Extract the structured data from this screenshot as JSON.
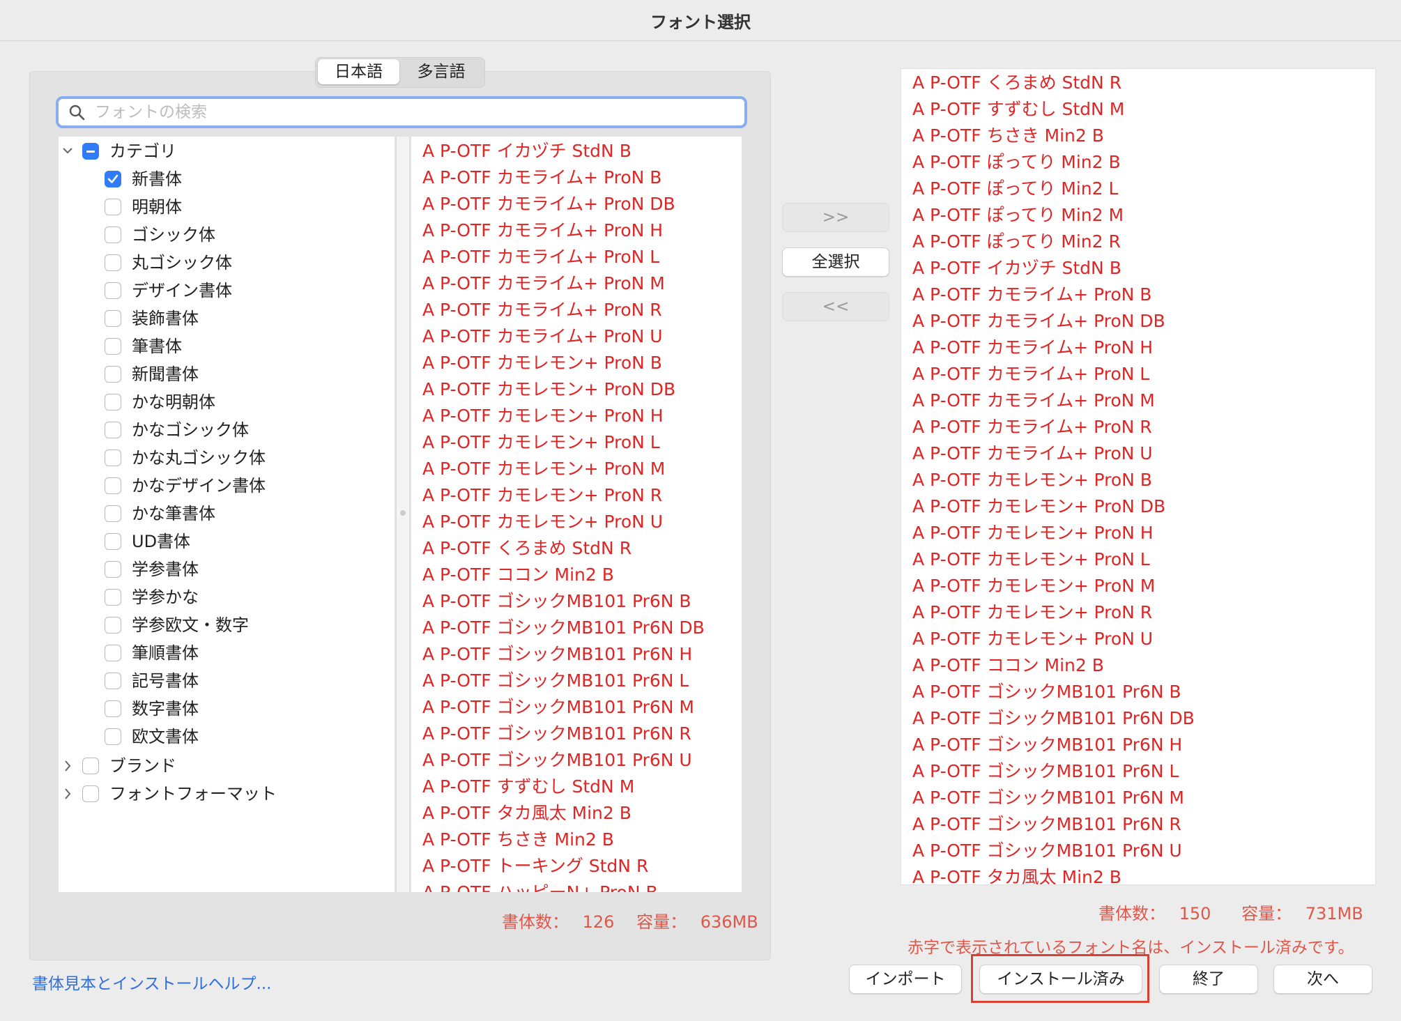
{
  "window": {
    "title": "フォント選択"
  },
  "tabs": [
    {
      "label": "日本語",
      "selected": true
    },
    {
      "label": "多言語",
      "selected": false
    }
  ],
  "search": {
    "placeholder": "フォントの検索",
    "value": ""
  },
  "tree": {
    "category": {
      "label": "カテゴリ",
      "state": "mixed",
      "expanded": true
    },
    "subcategories": [
      {
        "label": "新書体",
        "checked": true
      },
      {
        "label": "明朝体",
        "checked": false
      },
      {
        "label": "ゴシック体",
        "checked": false
      },
      {
        "label": "丸ゴシック体",
        "checked": false
      },
      {
        "label": "デザイン書体",
        "checked": false
      },
      {
        "label": "装飾書体",
        "checked": false
      },
      {
        "label": "筆書体",
        "checked": false
      },
      {
        "label": "新聞書体",
        "checked": false
      },
      {
        "label": "かな明朝体",
        "checked": false
      },
      {
        "label": "かなゴシック体",
        "checked": false
      },
      {
        "label": "かな丸ゴシック体",
        "checked": false
      },
      {
        "label": "かなデザイン書体",
        "checked": false
      },
      {
        "label": "かな筆書体",
        "checked": false
      },
      {
        "label": "UD書体",
        "checked": false
      },
      {
        "label": "学参書体",
        "checked": false
      },
      {
        "label": "学参かな",
        "checked": false
      },
      {
        "label": "学参欧文・数字",
        "checked": false
      },
      {
        "label": "筆順書体",
        "checked": false
      },
      {
        "label": "記号書体",
        "checked": false
      },
      {
        "label": "数字書体",
        "checked": false
      },
      {
        "label": "欧文書体",
        "checked": false
      }
    ],
    "groups": [
      {
        "label": "ブランド",
        "checked": false,
        "expanded": false
      },
      {
        "label": "フォントフォーマット",
        "checked": false,
        "expanded": false
      }
    ]
  },
  "available_fonts": [
    "A P-OTF イカヅチ StdN B",
    "A P-OTF カモライム+ ProN B",
    "A P-OTF カモライム+ ProN DB",
    "A P-OTF カモライム+ ProN H",
    "A P-OTF カモライム+ ProN L",
    "A P-OTF カモライム+ ProN M",
    "A P-OTF カモライム+ ProN R",
    "A P-OTF カモライム+ ProN U",
    "A P-OTF カモレモン+ ProN B",
    "A P-OTF カモレモン+ ProN DB",
    "A P-OTF カモレモン+ ProN H",
    "A P-OTF カモレモン+ ProN L",
    "A P-OTF カモレモン+ ProN M",
    "A P-OTF カモレモン+ ProN R",
    "A P-OTF カモレモン+ ProN U",
    "A P-OTF くろまめ StdN R",
    "A P-OTF ココン Min2 B",
    "A P-OTF ゴシックMB101 Pr6N B",
    "A P-OTF ゴシックMB101 Pr6N DB",
    "A P-OTF ゴシックMB101 Pr6N H",
    "A P-OTF ゴシックMB101 Pr6N L",
    "A P-OTF ゴシックMB101 Pr6N M",
    "A P-OTF ゴシックMB101 Pr6N R",
    "A P-OTF ゴシックMB101 Pr6N U",
    "A P-OTF すずむし StdN M",
    "A P-OTF タカ風太 Min2 B",
    "A P-OTF ちさき Min2 B",
    "A P-OTF トーキング StdN R",
    "A P-OTF ハッピーN+ ProN B"
  ],
  "available_stats": {
    "count_label": "書体数：",
    "count": "126",
    "size_label": "容量：",
    "size": "636MB"
  },
  "transfer": {
    "add_label": ">>",
    "select_all_label": "全選択",
    "remove_label": "<<"
  },
  "selected_fonts": [
    "A P-OTF くろまめ StdN R",
    "A P-OTF すずむし StdN M",
    "A P-OTF ちさき Min2 B",
    "A P-OTF ぽってり Min2 B",
    "A P-OTF ぽってり Min2 L",
    "A P-OTF ぽってり Min2 M",
    "A P-OTF ぽってり Min2 R",
    "A P-OTF イカヅチ StdN B",
    "A P-OTF カモライム+ ProN B",
    "A P-OTF カモライム+ ProN DB",
    "A P-OTF カモライム+ ProN H",
    "A P-OTF カモライム+ ProN L",
    "A P-OTF カモライム+ ProN M",
    "A P-OTF カモライム+ ProN R",
    "A P-OTF カモライム+ ProN U",
    "A P-OTF カモレモン+ ProN B",
    "A P-OTF カモレモン+ ProN DB",
    "A P-OTF カモレモン+ ProN H",
    "A P-OTF カモレモン+ ProN L",
    "A P-OTF カモレモン+ ProN M",
    "A P-OTF カモレモン+ ProN R",
    "A P-OTF カモレモン+ ProN U",
    "A P-OTF ココン Min2 B",
    "A P-OTF ゴシックMB101 Pr6N B",
    "A P-OTF ゴシックMB101 Pr6N DB",
    "A P-OTF ゴシックMB101 Pr6N H",
    "A P-OTF ゴシックMB101 Pr6N L",
    "A P-OTF ゴシックMB101 Pr6N M",
    "A P-OTF ゴシックMB101 Pr6N R",
    "A P-OTF ゴシックMB101 Pr6N U",
    "A P-OTF タカ風太 Min2 B"
  ],
  "selected_stats": {
    "count_label": "書体数：",
    "count": "150",
    "size_label": "容量：",
    "size": "731MB"
  },
  "installed_note": "赤字で表示されているフォント名は、インストール済みです。",
  "buttons": {
    "import": "インポート",
    "installed": "インストール済み",
    "quit": "終了",
    "next": "次へ"
  },
  "help_link": "書体見本とインストールヘルプ...",
  "colors": {
    "installed_font": "#e02525",
    "accent": "#2f7cf6",
    "highlight_box": "#d94032",
    "link": "#2f6fe0"
  }
}
